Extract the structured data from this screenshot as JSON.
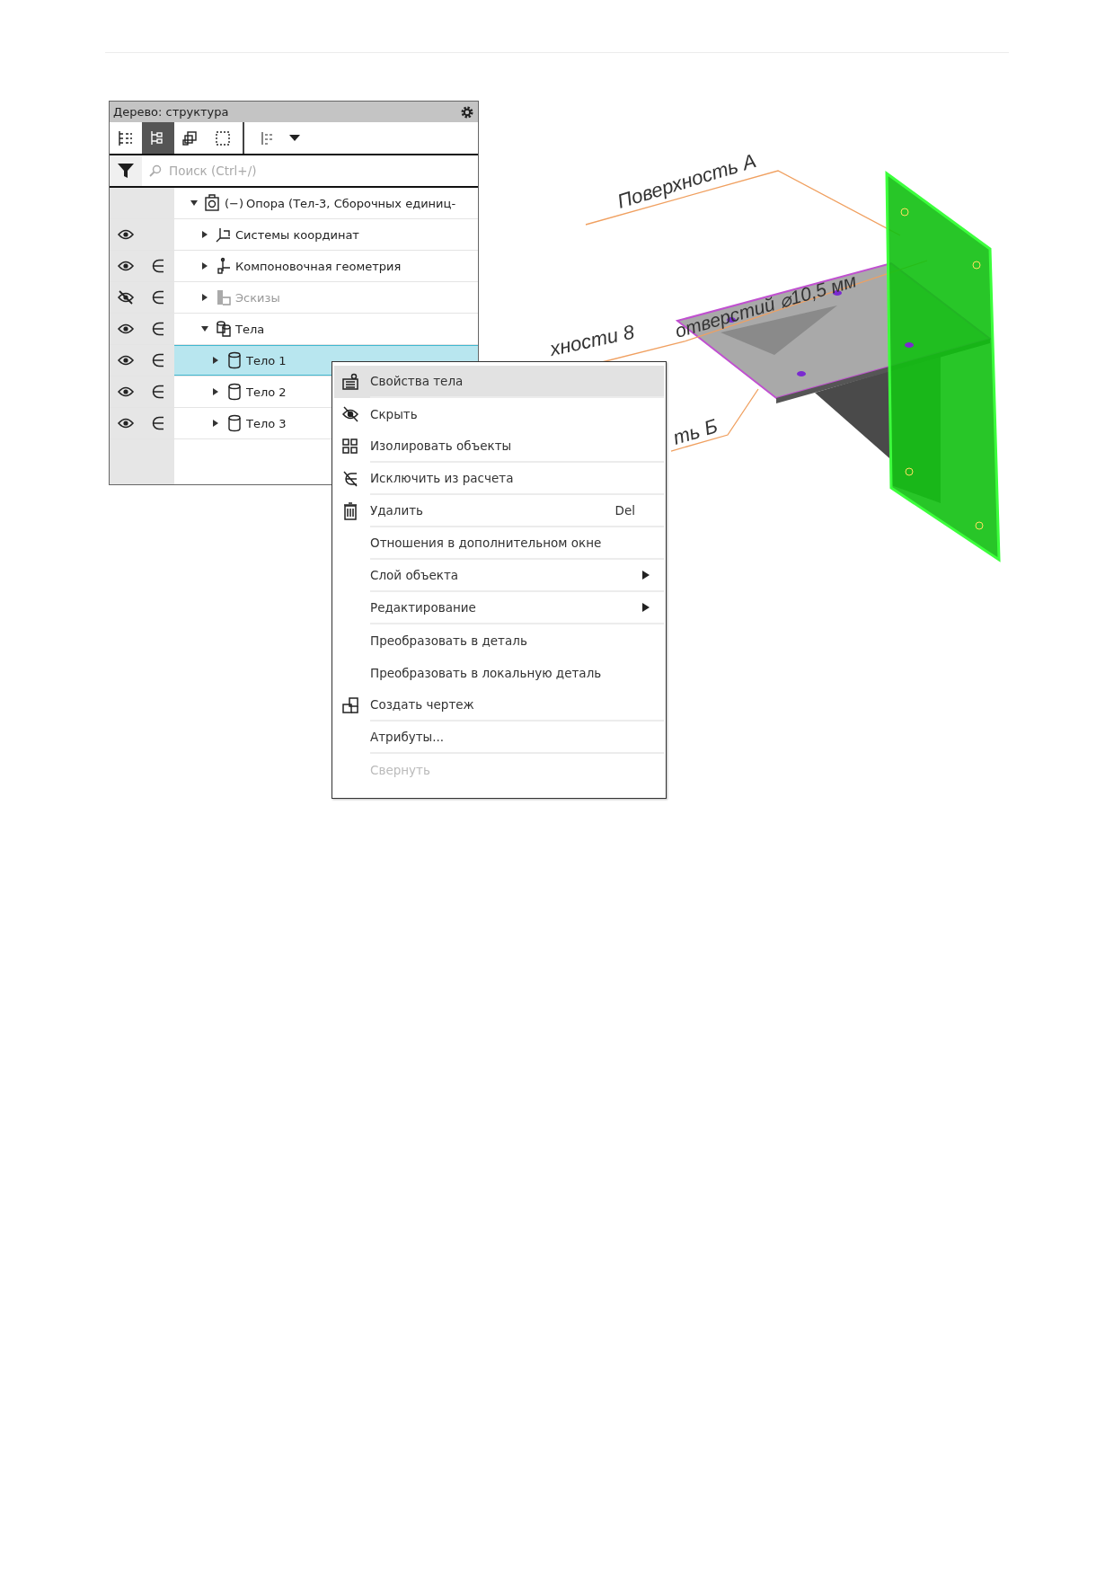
{
  "tree_panel": {
    "title": "Дерево: структура",
    "toolbar": [
      {
        "kind": "numbered",
        "selected": false
      },
      {
        "kind": "structure",
        "selected": true
      },
      {
        "kind": "components",
        "selected": false
      },
      {
        "kind": "frame",
        "selected": false
      },
      {
        "kind": "options",
        "selected": false
      }
    ],
    "search": {
      "placeholder": "Поиск (Ctrl+/)"
    },
    "tree": [
      {
        "prefix": "(−)",
        "label": "Опора (Тел-3, Сборочных единиц-",
        "kind": "assembly",
        "included": false,
        "expanded": true,
        "disabled": false,
        "selected": false,
        "children": [
          {
            "label": "Системы координат",
            "kind": "coords",
            "visible": true,
            "included": false,
            "expanded": false,
            "disabled": false,
            "selected": false
          },
          {
            "label": "Компоновочная геометрия",
            "kind": "layout",
            "visible": true,
            "included": true,
            "expanded": false,
            "disabled": false,
            "selected": false
          },
          {
            "label": "Эскизы",
            "kind": "sketch",
            "visible": false,
            "included": true,
            "expanded": false,
            "disabled": true,
            "selected": false
          },
          {
            "label": "Тела",
            "kind": "bodies",
            "visible": true,
            "included": true,
            "expanded": true,
            "disabled": false,
            "selected": false,
            "children": [
              {
                "label": "Тело 1",
                "kind": "body",
                "visible": true,
                "included": true,
                "expanded": false,
                "disabled": false,
                "selected": true
              },
              {
                "label": "Тело 2",
                "kind": "body",
                "visible": true,
                "included": true,
                "expanded": false,
                "disabled": false,
                "selected": false
              },
              {
                "label": "Тело 3",
                "kind": "body",
                "visible": true,
                "included": true,
                "expanded": false,
                "disabled": false,
                "selected": false
              }
            ]
          }
        ]
      }
    ]
  },
  "context_menu": {
    "items": [
      {
        "label": "Свойства тела",
        "kind": "properties",
        "selected": true,
        "disabled": false,
        "submenu": false,
        "separator_after": true
      },
      {
        "label": "Скрыть",
        "kind": "hide",
        "selected": false,
        "disabled": false,
        "submenu": false,
        "separator_after": false
      },
      {
        "label": "Изолировать объекты",
        "kind": "isolate",
        "selected": false,
        "disabled": false,
        "submenu": false,
        "separator_after": true
      },
      {
        "label": "Исключить из расчета",
        "kind": "exclude",
        "selected": false,
        "disabled": false,
        "submenu": false,
        "separator_after": true
      },
      {
        "label": "Удалить",
        "kind": "delete",
        "shortcut": "Del",
        "selected": false,
        "disabled": false,
        "submenu": false,
        "separator_after": true
      },
      {
        "label": "Отношения в дополнительном окне",
        "kind": "plain",
        "selected": false,
        "disabled": false,
        "submenu": false,
        "separator_after": true
      },
      {
        "label": "Слой объекта",
        "kind": "plain",
        "selected": false,
        "disabled": false,
        "submenu": true,
        "separator_after": true
      },
      {
        "label": "Редактирование",
        "kind": "plain",
        "selected": false,
        "disabled": false,
        "submenu": true,
        "separator_after": true
      },
      {
        "label": "Преобразовать в деталь",
        "kind": "plain",
        "selected": false,
        "disabled": false,
        "submenu": false,
        "separator_after": false
      },
      {
        "label": "Преобразовать в локальную деталь",
        "kind": "plain",
        "selected": false,
        "disabled": false,
        "submenu": false,
        "separator_after": false
      },
      {
        "label": "Создать чертеж",
        "kind": "drawing",
        "selected": false,
        "disabled": false,
        "submenu": false,
        "separator_after": true
      },
      {
        "label": "Атрибуты...",
        "kind": "plain",
        "selected": false,
        "disabled": false,
        "submenu": false,
        "separator_after": true
      },
      {
        "label": "Свернуть",
        "kind": "plain",
        "selected": false,
        "disabled": true,
        "submenu": false,
        "separator_after": false
      }
    ]
  },
  "model_view": {
    "annotations": [
      {
        "text": "Поверхность А"
      },
      {
        "text": "хности 8"
      },
      {
        "text": "отверстий ⌀10,5 мм"
      },
      {
        "text": "ть Б"
      }
    ]
  }
}
